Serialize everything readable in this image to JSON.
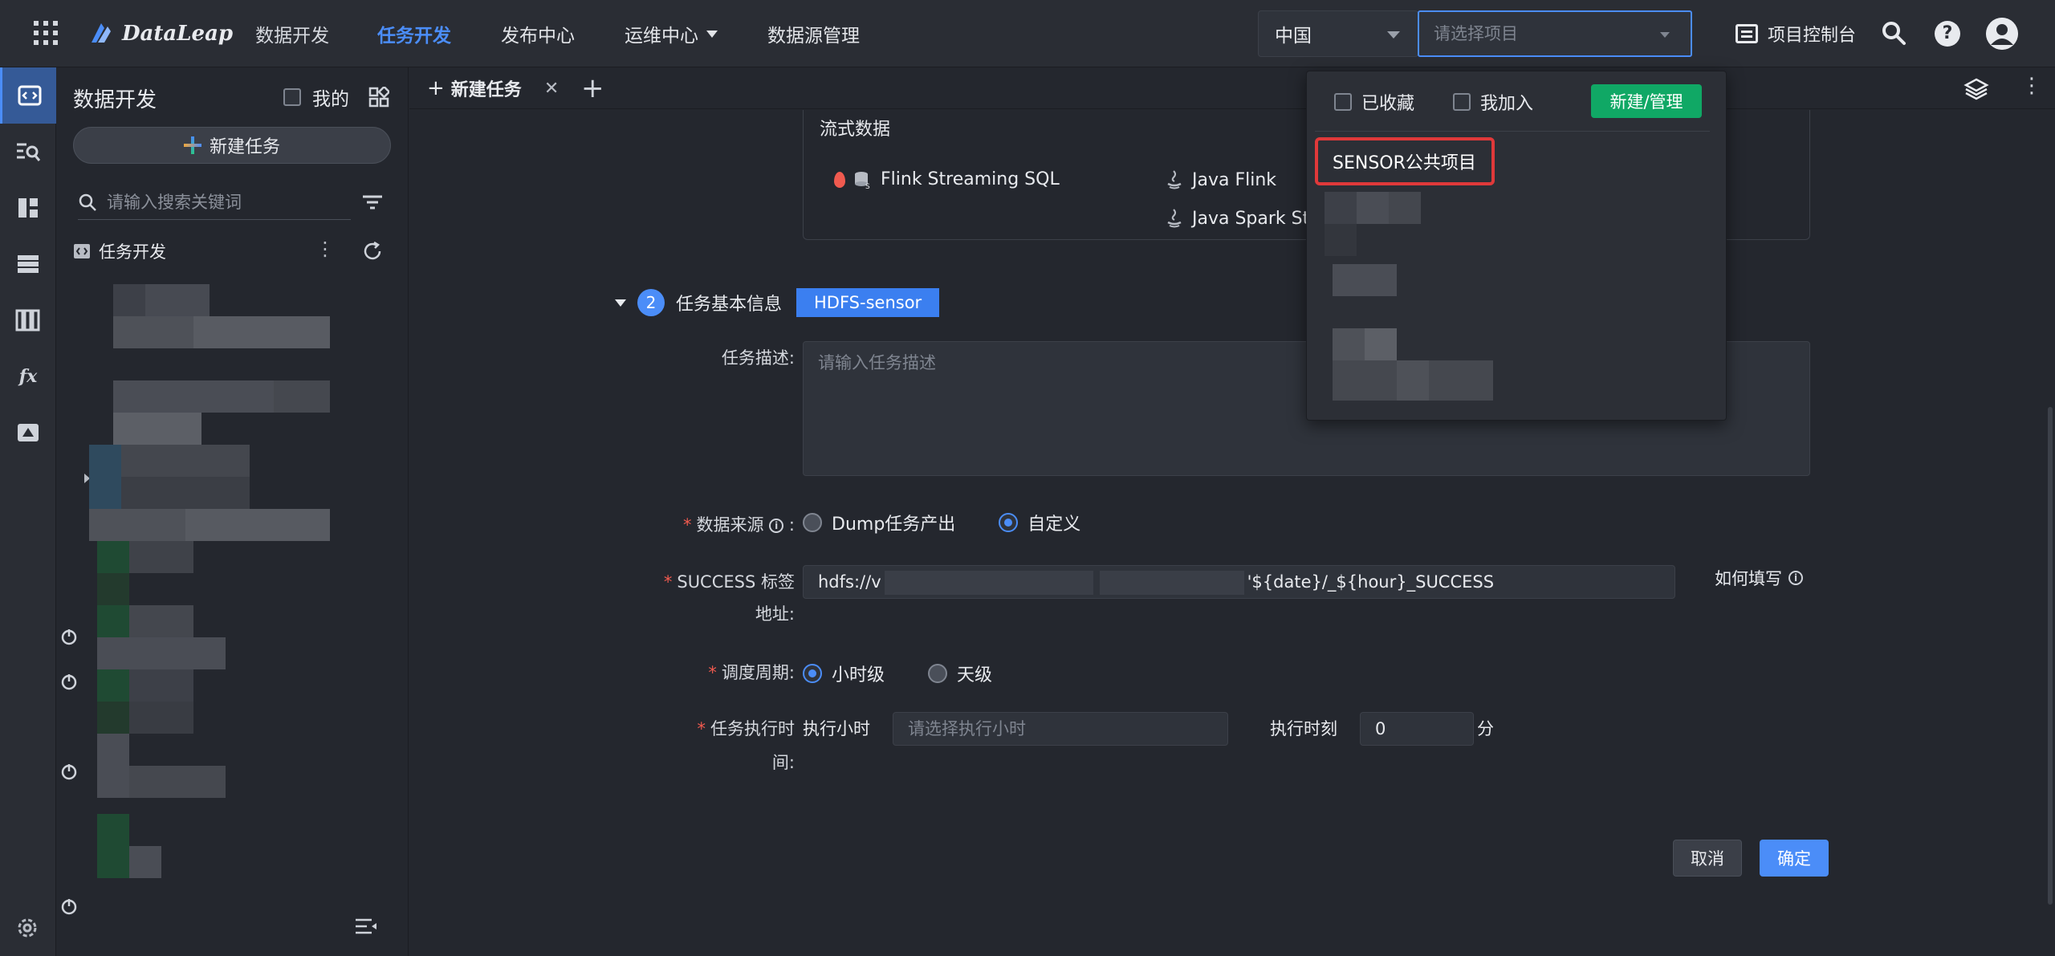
{
  "topbar": {
    "app_title": "DataLeap",
    "app_subtitle": "数据开发",
    "nav": [
      "任务开发",
      "发布中心",
      "运维中心",
      "数据源管理"
    ],
    "region": "中国",
    "project_placeholder": "请选择项目",
    "console_label": "项目控制台"
  },
  "sidebar": {
    "title": "数据开发",
    "mine_label": "我的",
    "new_task_label": "新建任务",
    "search_placeholder": "请输入搜索关键词",
    "tree_root": "任务开发"
  },
  "tabs": {
    "active": "新建任务"
  },
  "stream": {
    "title": "流式数据",
    "options": [
      "Flink Streaming SQL",
      "Java Flink",
      "Java Spark Stre"
    ]
  },
  "form": {
    "section_number": "2",
    "section_title": "任务基本信息",
    "task_type_tag": "HDFS-sensor",
    "desc_label": "任务描述:",
    "desc_placeholder": "请输入任务描述",
    "source_label": "数据来源",
    "source_options": [
      "Dump任务产出",
      "自定义"
    ],
    "source_selected": "自定义",
    "success_label_line1": "SUCCESS 标签",
    "success_label_line2": "地址:",
    "success_prefix": "hdfs://v",
    "success_suffix": "'${date}/_${hour}_SUCCESS",
    "how_fill": "如何填写",
    "cycle_label": "调度周期:",
    "cycle_options": [
      "小时级",
      "天级"
    ],
    "cycle_selected": "小时级",
    "exec_label_line1": "任务执行时",
    "exec_label_line2": "间:",
    "exec_hour_label": "执行小时",
    "exec_hour_placeholder": "请选择执行小时",
    "exec_minute_label": "执行时刻",
    "exec_minute_value": "0",
    "exec_minute_unit": "分",
    "cancel": "取消",
    "ok": "确定"
  },
  "project_dropdown": {
    "favorites_label": "已收藏",
    "joined_label": "我加入",
    "manage_button": "新建/管理",
    "highlighted_item": "SENSOR公共项目"
  },
  "colors": {
    "accent": "#4b8df8",
    "manage_green": "#10a865",
    "highlight_red": "#e0393a",
    "required_red": "#f05a4f"
  }
}
